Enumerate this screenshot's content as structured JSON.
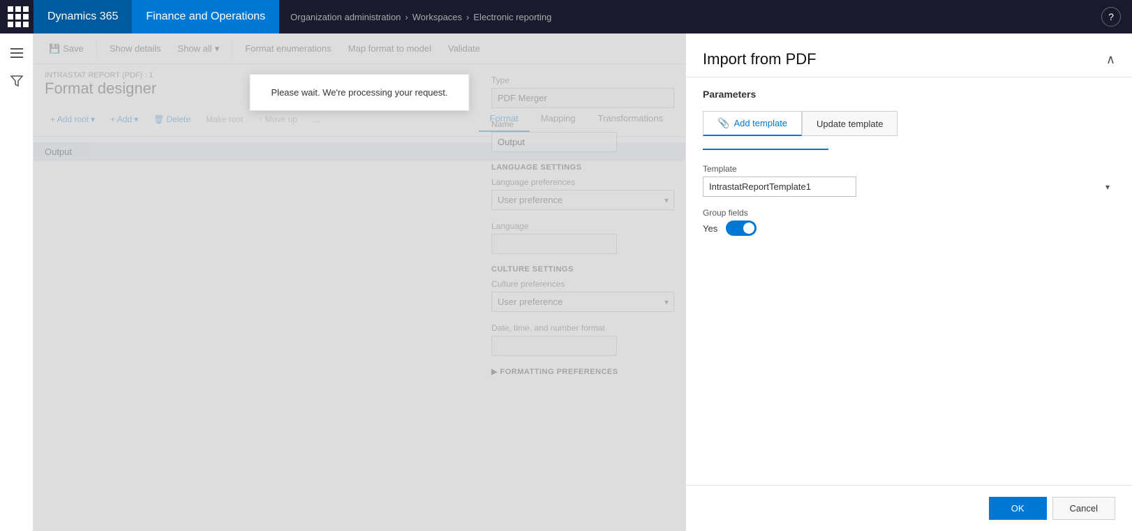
{
  "topnav": {
    "brand_d365": "Dynamics 365",
    "brand_fo": "Finance and Operations",
    "breadcrumb": {
      "org_admin": "Organization administration",
      "workspaces": "Workspaces",
      "electronic_reporting": "Electronic reporting"
    }
  },
  "toolbar": {
    "save": "Save",
    "show_details": "Show details",
    "show_all": "Show all",
    "format_enumerations": "Format enumerations",
    "map_format": "Map format to model",
    "validate": "Validate"
  },
  "page": {
    "breadcrumb": "INTRASTAT REPORT (PDF) : 1",
    "title": "Format designer"
  },
  "format_toolbar": {
    "add_root": "+ Add root",
    "add": "+ Add",
    "delete": "Delete",
    "make_root": "Make root",
    "move_up": "↑ Move up",
    "more": "..."
  },
  "tabs": {
    "format": "Format",
    "mapping": "Mapping",
    "transformations": "Transformations"
  },
  "tree": {
    "output_item": "Output"
  },
  "form": {
    "type_label": "Type",
    "type_value": "PDF Merger",
    "name_label": "Name",
    "name_value": "Output",
    "language_settings_label": "LANGUAGE SETTINGS",
    "language_pref_label": "Language preferences",
    "language_pref_value": "User preference",
    "language_label": "Language",
    "culture_settings_label": "CULTURE SETTINGS",
    "culture_pref_label": "Culture preferences",
    "culture_pref_value": "User preference",
    "date_format_label": "Date, time, and number format",
    "formatting_pref_label": "FORMATTING PREFERENCES"
  },
  "toast": {
    "message": "Please wait. We're processing your request."
  },
  "right_panel": {
    "title": "Import from PDF",
    "section_title": "Parameters",
    "tab_add_template": "Add template",
    "tab_update_template": "Update template",
    "template_label": "Template",
    "template_value": "IntrastatReportTemplate1",
    "group_fields_label": "Group fields",
    "group_fields_value": "Yes",
    "ok_label": "OK",
    "cancel_label": "Cancel"
  }
}
